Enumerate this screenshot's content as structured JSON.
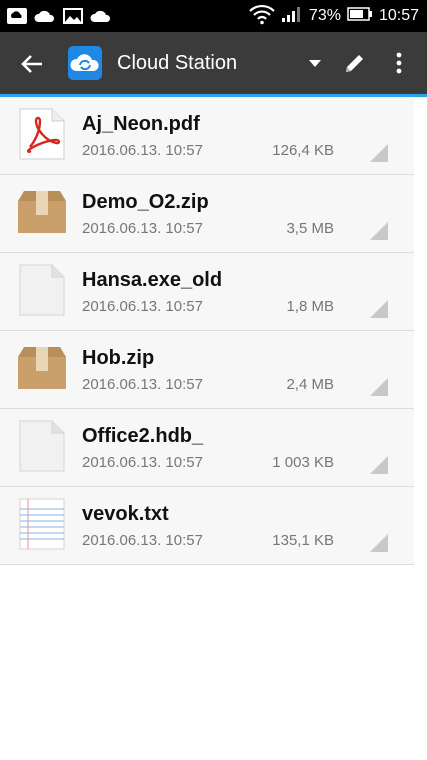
{
  "status_bar": {
    "battery": "73%",
    "time": "10:57"
  },
  "app_bar": {
    "title": "Cloud Station"
  },
  "files": [
    {
      "name": "Aj_Neon.pdf",
      "date": "2016.06.13. 10:57",
      "size": "126,4 KB",
      "icon": "pdf-icon"
    },
    {
      "name": "Demo_O2.zip",
      "date": "2016.06.13. 10:57",
      "size": "3,5 MB",
      "icon": "zip-icon"
    },
    {
      "name": "Hansa.exe_old",
      "date": "2016.06.13. 10:57",
      "size": "1,8 MB",
      "icon": "generic-file-icon"
    },
    {
      "name": "Hob.zip",
      "date": "2016.06.13. 10:57",
      "size": "2,4 MB",
      "icon": "zip-icon"
    },
    {
      "name": "Office2.hdb_",
      "date": "2016.06.13. 10:57",
      "size": "1 003 KB",
      "icon": "generic-file-icon"
    },
    {
      "name": "vevok.txt",
      "date": "2016.06.13. 10:57",
      "size": "135,1 KB",
      "icon": "text-file-icon"
    }
  ],
  "colors": {
    "appbar": "#3b3b3b",
    "accent": "#2aa6e6",
    "pdf_red": "#d7261e"
  }
}
